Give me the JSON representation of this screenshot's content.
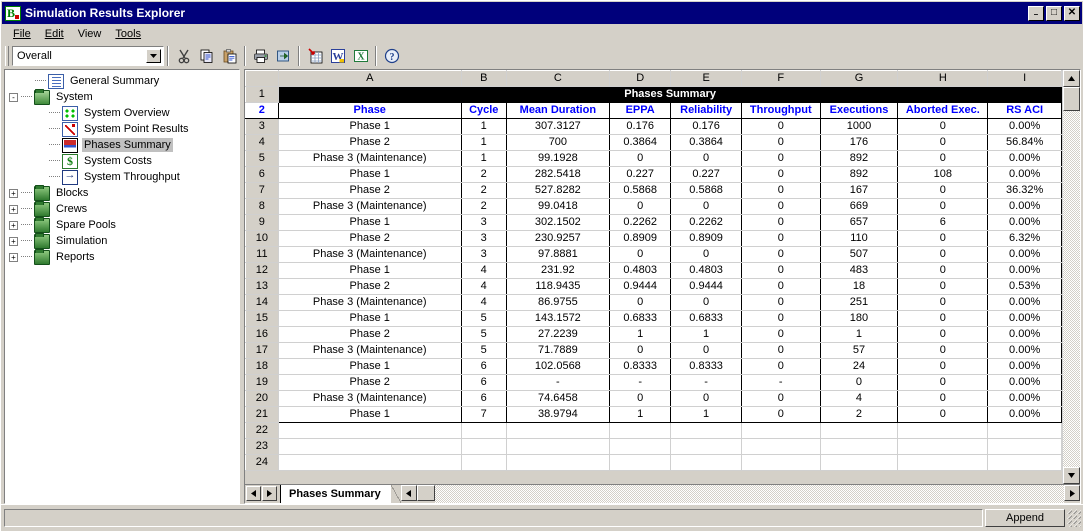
{
  "window": {
    "title": "Simulation Results Explorer",
    "icon": "app-icon",
    "buttons": {
      "minimize": "–",
      "maximize": "□",
      "close": "✕"
    }
  },
  "menu": {
    "items": [
      {
        "label": "File"
      },
      {
        "label": "Edit"
      },
      {
        "label": "View"
      },
      {
        "label": "Tools"
      }
    ]
  },
  "toolbar": {
    "combo": {
      "value": "Overall",
      "arrow": "▼"
    },
    "buttons": [
      {
        "name": "cut-icon",
        "label": "Cut"
      },
      {
        "name": "copy-icon",
        "label": "Copy"
      },
      {
        "name": "paste-icon",
        "label": "Paste"
      },
      {
        "name": "print-icon",
        "label": "Print"
      },
      {
        "name": "export-icon",
        "label": "Export"
      },
      {
        "name": "insert-table-icon",
        "label": "Insert Table"
      },
      {
        "name": "word-export-icon",
        "label": "Export to Word"
      },
      {
        "name": "excel-export-icon",
        "label": "Export to Excel"
      },
      {
        "name": "help-icon",
        "label": "Help"
      }
    ]
  },
  "tree": {
    "nodes": [
      {
        "label": "General Summary",
        "icon": "list-icon",
        "level": 1,
        "expander": "",
        "selected": false
      },
      {
        "label": "System",
        "icon": "folder-open-icon",
        "level": 0,
        "expander": "-",
        "selected": false
      },
      {
        "label": "System Overview",
        "icon": "overview-icon",
        "level": 2,
        "expander": "",
        "selected": false
      },
      {
        "label": "System Point Results",
        "icon": "point-results-icon",
        "level": 2,
        "expander": "",
        "selected": false
      },
      {
        "label": "Phases Summary",
        "icon": "phases-summary-icon",
        "level": 2,
        "expander": "",
        "selected": true
      },
      {
        "label": "System Costs",
        "icon": "costs-icon",
        "level": 2,
        "expander": "",
        "selected": false
      },
      {
        "label": "System Throughput",
        "icon": "throughput-icon",
        "level": 2,
        "expander": "",
        "selected": false
      },
      {
        "label": "Blocks",
        "icon": "folder-icon",
        "level": 0,
        "expander": "+",
        "selected": false
      },
      {
        "label": "Crews",
        "icon": "folder-icon",
        "level": 0,
        "expander": "+",
        "selected": false
      },
      {
        "label": "Spare Pools",
        "icon": "folder-icon",
        "level": 0,
        "expander": "+",
        "selected": false
      },
      {
        "label": "Simulation",
        "icon": "folder-icon",
        "level": 0,
        "expander": "+",
        "selected": false
      },
      {
        "label": "Reports",
        "icon": "folder-icon",
        "level": 0,
        "expander": "+",
        "selected": false
      }
    ]
  },
  "sheet": {
    "column_letters": [
      "A",
      "B",
      "C",
      "D",
      "E",
      "F",
      "G",
      "H",
      "I"
    ],
    "title": "Phases Summary",
    "headers": [
      "Phase",
      "Cycle",
      "Mean Duration",
      "EPPA",
      "Reliability",
      "Throughput",
      "Executions",
      "Aborted Exec.",
      "RS ACI"
    ],
    "header_color": "#0000ff",
    "title_bg": "#000000",
    "title_fg": "#ffffff",
    "rows": [
      {
        "n": "3",
        "cells": [
          "Phase 1",
          "1",
          "307.3127",
          "0.176",
          "0.176",
          "0",
          "1000",
          "0",
          "0.00%"
        ]
      },
      {
        "n": "4",
        "cells": [
          "Phase 2",
          "1",
          "700",
          "0.3864",
          "0.3864",
          "0",
          "176",
          "0",
          "56.84%"
        ]
      },
      {
        "n": "5",
        "cells": [
          "Phase 3 (Maintenance)",
          "1",
          "99.1928",
          "0",
          "0",
          "0",
          "892",
          "0",
          "0.00%"
        ]
      },
      {
        "n": "6",
        "cells": [
          "Phase 1",
          "2",
          "282.5418",
          "0.227",
          "0.227",
          "0",
          "892",
          "108",
          "0.00%"
        ]
      },
      {
        "n": "7",
        "cells": [
          "Phase 2",
          "2",
          "527.8282",
          "0.5868",
          "0.5868",
          "0",
          "167",
          "0",
          "36.32%"
        ]
      },
      {
        "n": "8",
        "cells": [
          "Phase 3 (Maintenance)",
          "2",
          "99.0418",
          "0",
          "0",
          "0",
          "669",
          "0",
          "0.00%"
        ]
      },
      {
        "n": "9",
        "cells": [
          "Phase 1",
          "3",
          "302.1502",
          "0.2262",
          "0.2262",
          "0",
          "657",
          "6",
          "0.00%"
        ]
      },
      {
        "n": "10",
        "cells": [
          "Phase 2",
          "3",
          "230.9257",
          "0.8909",
          "0.8909",
          "0",
          "110",
          "0",
          "6.32%"
        ]
      },
      {
        "n": "11",
        "cells": [
          "Phase 3 (Maintenance)",
          "3",
          "97.8881",
          "0",
          "0",
          "0",
          "507",
          "0",
          "0.00%"
        ]
      },
      {
        "n": "12",
        "cells": [
          "Phase 1",
          "4",
          "231.92",
          "0.4803",
          "0.4803",
          "0",
          "483",
          "0",
          "0.00%"
        ]
      },
      {
        "n": "13",
        "cells": [
          "Phase 2",
          "4",
          "118.9435",
          "0.9444",
          "0.9444",
          "0",
          "18",
          "0",
          "0.53%"
        ]
      },
      {
        "n": "14",
        "cells": [
          "Phase 3 (Maintenance)",
          "4",
          "86.9755",
          "0",
          "0",
          "0",
          "251",
          "0",
          "0.00%"
        ]
      },
      {
        "n": "15",
        "cells": [
          "Phase 1",
          "5",
          "143.1572",
          "0.6833",
          "0.6833",
          "0",
          "180",
          "0",
          "0.00%"
        ]
      },
      {
        "n": "16",
        "cells": [
          "Phase 2",
          "5",
          "27.2239",
          "1",
          "1",
          "0",
          "1",
          "0",
          "0.00%"
        ]
      },
      {
        "n": "17",
        "cells": [
          "Phase 3 (Maintenance)",
          "5",
          "71.7889",
          "0",
          "0",
          "0",
          "57",
          "0",
          "0.00%"
        ]
      },
      {
        "n": "18",
        "cells": [
          "Phase 1",
          "6",
          "102.0568",
          "0.8333",
          "0.8333",
          "0",
          "24",
          "0",
          "0.00%"
        ]
      },
      {
        "n": "19",
        "cells": [
          "Phase 2",
          "6",
          "-",
          "-",
          "-",
          "-",
          "0",
          "0",
          "0.00%"
        ]
      },
      {
        "n": "20",
        "cells": [
          "Phase 3 (Maintenance)",
          "6",
          "74.6458",
          "0",
          "0",
          "0",
          "4",
          "0",
          "0.00%"
        ]
      },
      {
        "n": "21",
        "cells": [
          "Phase 1",
          "7",
          "38.9794",
          "1",
          "1",
          "0",
          "2",
          "0",
          "0.00%"
        ]
      }
    ],
    "empty_rows": [
      "22",
      "23",
      "24"
    ],
    "title_row_number": "1",
    "header_row_number": "2",
    "tab": {
      "label": "Phases Summary"
    }
  },
  "statusbar": {
    "message": "",
    "append_label": "Append"
  },
  "glyphs": {
    "up": "▲",
    "down": "▼",
    "left": "◄",
    "right": "►"
  }
}
